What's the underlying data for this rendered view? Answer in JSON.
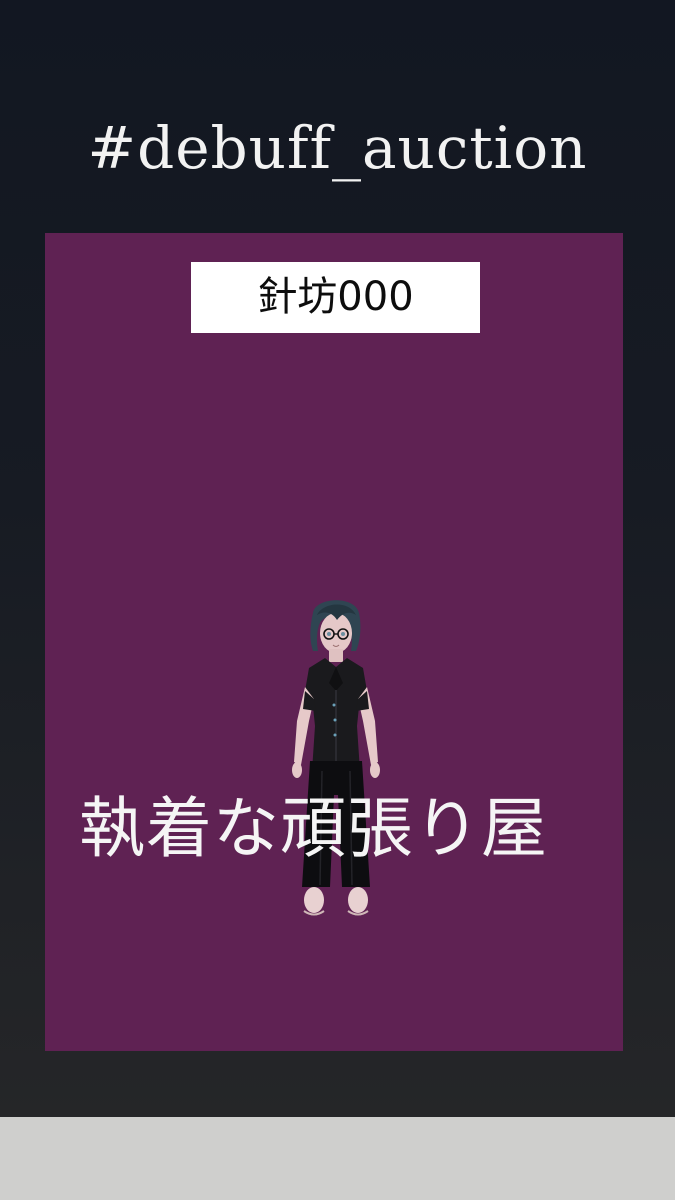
{
  "hashtag": "#debuff_auction",
  "card": {
    "name": "針坊000",
    "tagline": "執着な頑張り屋",
    "background_color": "#5f2253"
  },
  "figure": {
    "icon": "avatar-character"
  }
}
